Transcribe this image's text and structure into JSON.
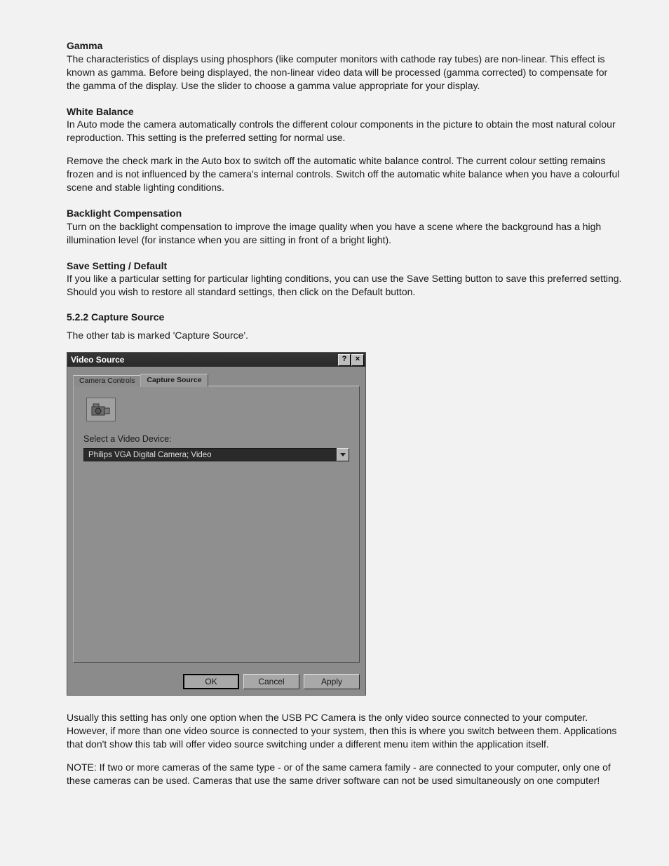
{
  "sections": {
    "gamma": {
      "heading": "Gamma",
      "body": "The characteristics of displays using phosphors (like computer monitors with cathode ray tubes) are non-linear. This effect is known as gamma. Before being displayed, the non-linear video data will be processed (gamma corrected) to compensate for the gamma of the display. Use the slider to choose a gamma value appropriate for your display."
    },
    "white_balance": {
      "heading": "White Balance",
      "p1": "In Auto mode the camera automatically controls the different colour components in the picture to obtain the most natural colour reproduction. This setting is the preferred setting for normal use.",
      "p2": "Remove the check mark in the Auto box to switch off the automatic white balance control. The current colour setting remains frozen and is not influenced by the camera's internal controls. Switch off the automatic white balance when you have a colourful scene and stable lighting conditions."
    },
    "backlight": {
      "heading": "Backlight Compensation",
      "body": "Turn on the backlight compensation to improve the image quality when you have a scene where the background has a high illumination level (for instance when you are sitting in front of a bright light)."
    },
    "save_default": {
      "heading": "Save Setting / Default",
      "body": "If you like a particular setting for particular lighting conditions, you can use the Save Setting button to save this preferred setting. Should you wish to restore all standard settings, then click on the Default button."
    }
  },
  "capture_source": {
    "number_heading": "5.2.2 Capture Source",
    "intro": "The other tab is marked 'Capture Source'.",
    "after1": "Usually this setting has only one option when the USB PC Camera is the only video source connected to your computer. However, if more than one video source is connected to your system, then this is where you switch between them. Applications that don't show this tab will offer video source switching under a different menu item within the application itself.",
    "after2": "NOTE: If two or more cameras of the same type - or of the same camera family - are connected to your computer, only one of these cameras can be used. Cameras that use the same driver software can not be used simultaneously on one computer!"
  },
  "dialog": {
    "title": "Video Source",
    "help_glyph": "?",
    "close_glyph": "×",
    "tabs": {
      "camera_controls": "Camera Controls",
      "capture_source": "Capture Source"
    },
    "field_label": "Select a Video Device:",
    "device_value": "Philips VGA Digital Camera; Video",
    "buttons": {
      "ok": "OK",
      "cancel": "Cancel",
      "apply": "Apply"
    }
  }
}
